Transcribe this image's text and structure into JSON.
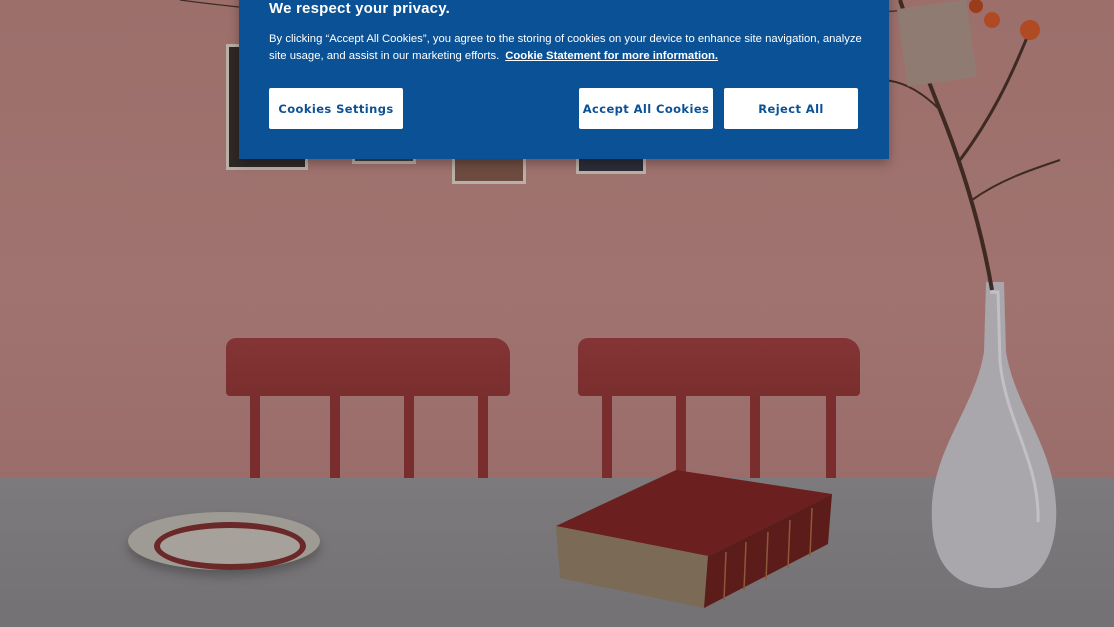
{
  "cookie_banner": {
    "title": "We respect your privacy.",
    "body": "By clicking “Accept All Cookies”, you agree to the storing of cookies on your device to enhance site navigation, analyze site usage, and assist in our marketing efforts.",
    "link_label": "Cookie Statement for more information.",
    "buttons": {
      "settings": "Cookies Settings",
      "accept": "Accept All Cookies",
      "reject": "Reject All"
    },
    "colors": {
      "background": "#0b5195",
      "button_text": "#0b5195",
      "button_bg": "#ffffff"
    }
  },
  "hero_image": {
    "description_icon": "still-life-photo"
  }
}
